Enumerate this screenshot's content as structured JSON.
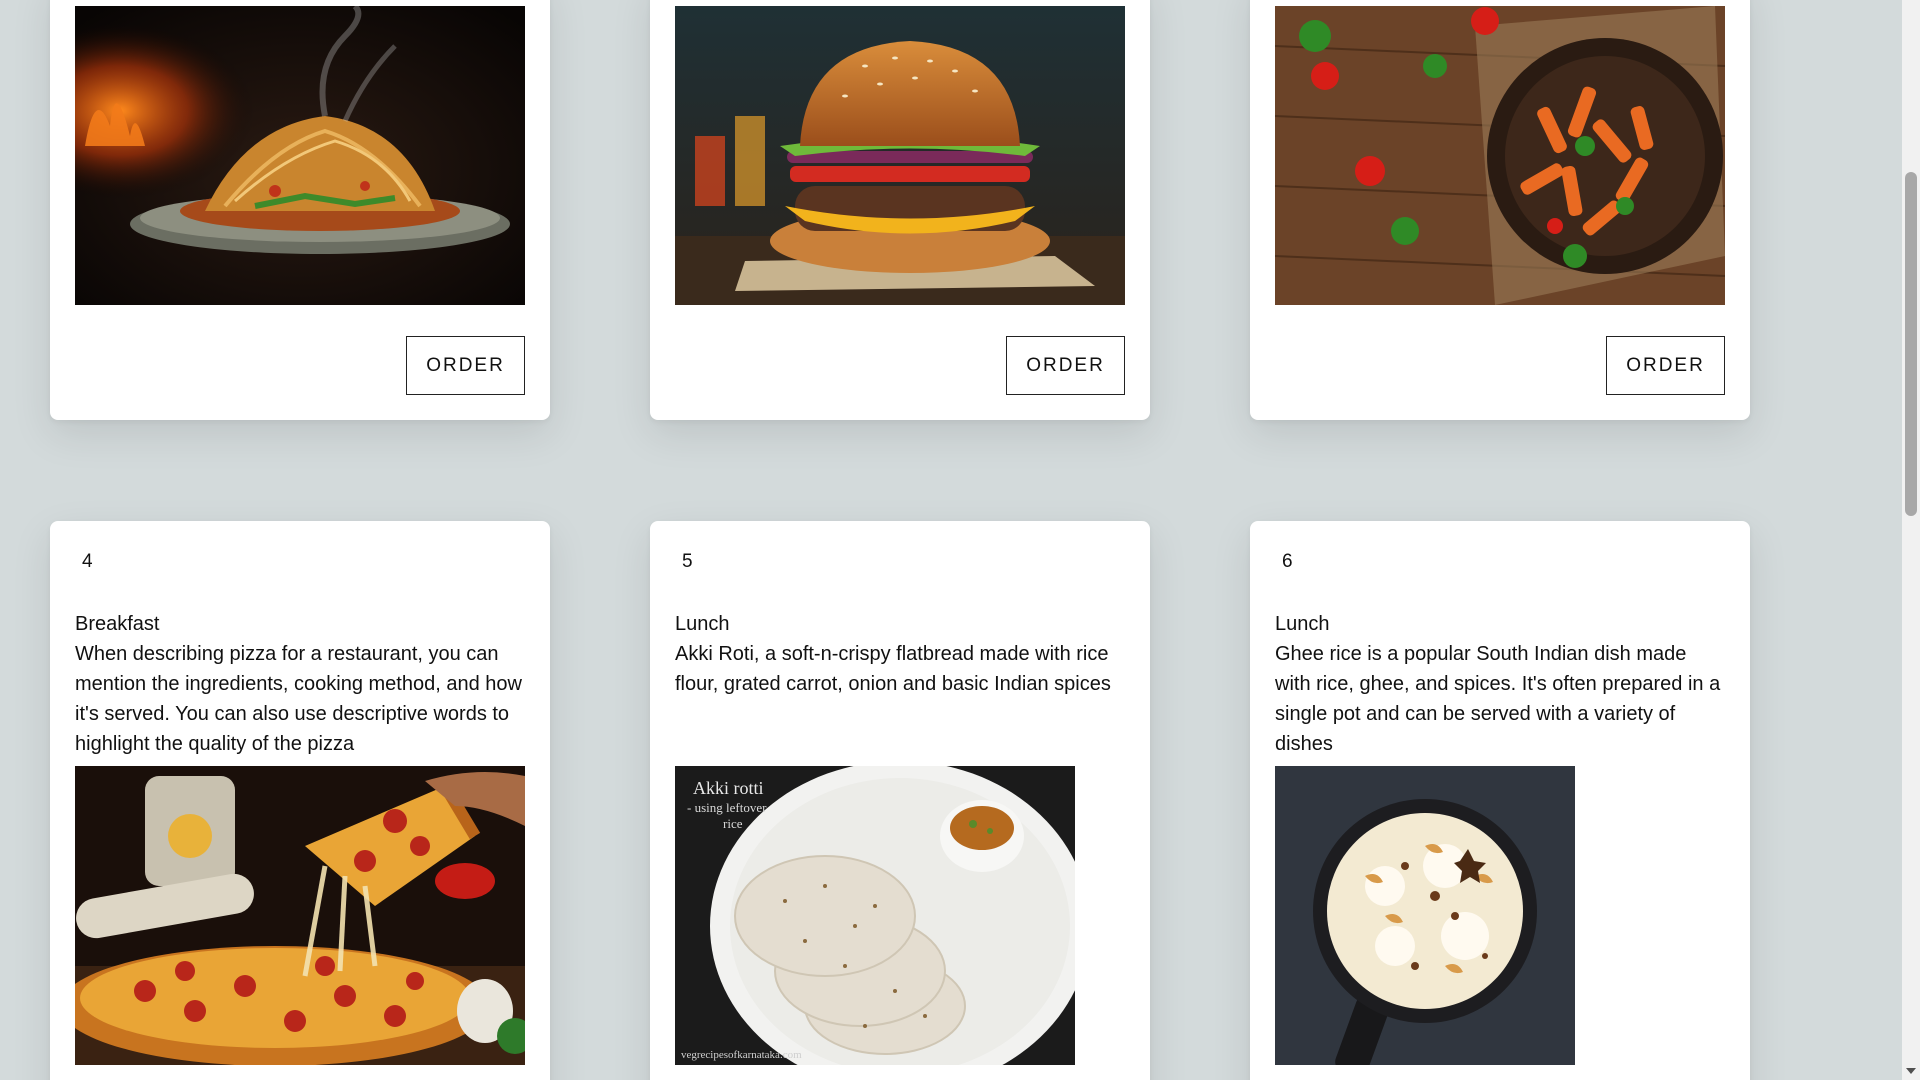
{
  "top_cards": [
    {
      "image": "noodles-photo",
      "order_label": "ORDER"
    },
    {
      "image": "burger-photo",
      "order_label": "ORDER"
    },
    {
      "image": "pasta-photo",
      "order_label": "ORDER"
    }
  ],
  "bottom_cards": [
    {
      "number": "4",
      "category": "Breakfast",
      "description": "When describing pizza for a restaurant, you can mention the ingredients, cooking method, and how it's served. You can also use descriptive words to highlight the quality of the pizza",
      "image": "pizza-photo"
    },
    {
      "number": "5",
      "category": "Lunch",
      "description": "Akki Roti, a soft-n-crispy flatbread made with rice flour, grated carrot, onion and basic Indian spices",
      "image": "akki-roti-photo",
      "image_caption_title": "Akki rotti",
      "image_caption_sub1": "- using leftover",
      "image_caption_sub2": "rice",
      "image_watermark": "vegrecipesofkarnataka.com"
    },
    {
      "number": "6",
      "category": "Lunch",
      "description": "Ghee rice is a popular South Indian dish made with rice, ghee, and spices. It's often prepared in a single pot and can be served with a variety of dishes",
      "image": "ghee-rice-photo"
    }
  ],
  "colors": {
    "page_background": "#d3dadb",
    "card_background": "#ffffff",
    "text": "#111111"
  }
}
